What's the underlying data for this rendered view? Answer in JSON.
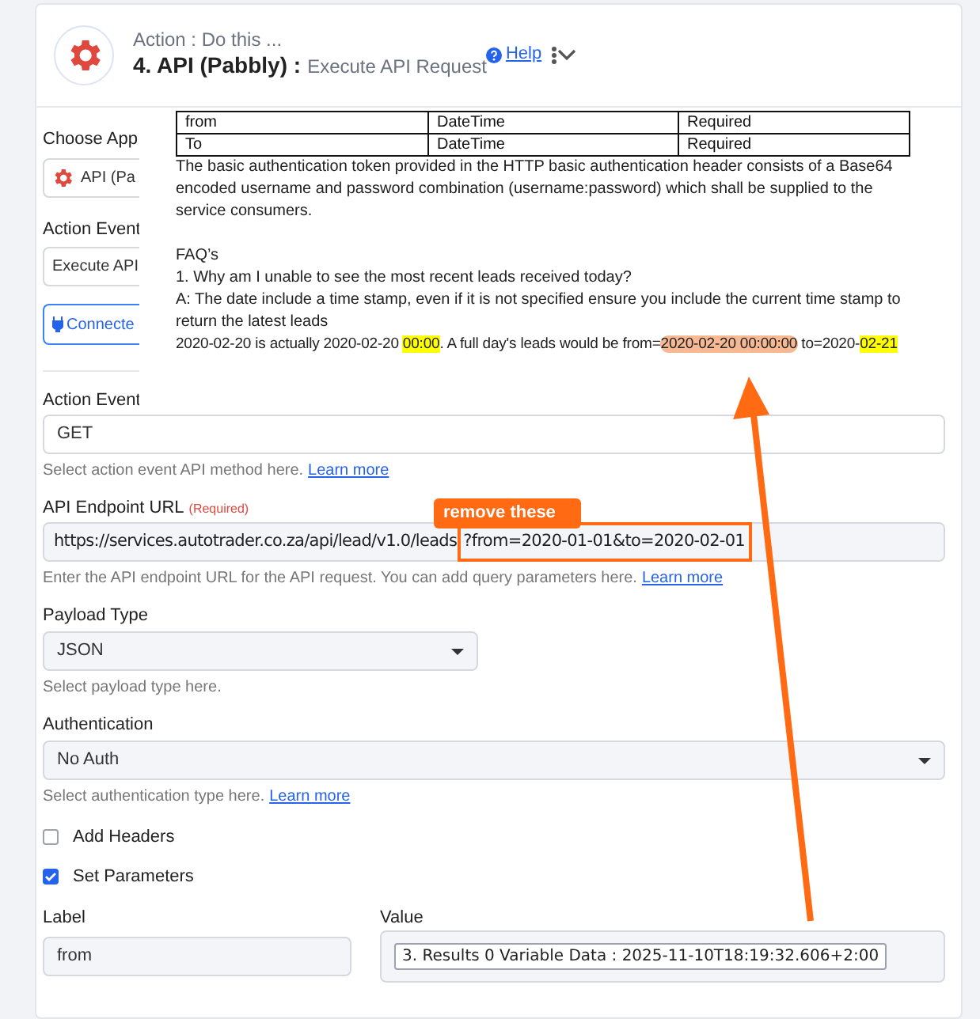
{
  "header": {
    "subtitle": "Action : Do this ...",
    "title": "4. API (Pabbly) :",
    "title_detail": "Execute API Request",
    "help": "Help"
  },
  "partial": {
    "choose_app_label": "Choose App",
    "app_value": "API (Pa",
    "action_event_label": "Action Event",
    "action_event_value": "Execute API",
    "connect_button": "Connecte"
  },
  "document": {
    "table": [
      [
        "from",
        "DateTime",
        "Required"
      ],
      [
        "To",
        "DateTime",
        "Required"
      ]
    ],
    "paragraph": "The basic authentication token provided in the HTTP basic authentication header consists of a Base64 encoded username and password combination (username:password) which shall be supplied to the service consumers.",
    "faq_title": "FAQ’s",
    "question": "1. Why am I unable to see the most recent leads received today?",
    "answer": "A: The date include a time stamp, even if it is not specified ensure you include the current time stamp to return the latest leads",
    "example": [
      {
        "text": "2020-02-20 is actually 2020-02-20 ",
        "kind": "plain"
      },
      {
        "text": "00:00",
        "kind": "yellow"
      },
      {
        "text": ". A full day's leads would be from=",
        "kind": "plain"
      },
      {
        "text": "2020-02-20 00:00:00",
        "kind": "salmon"
      },
      {
        "text": " to=2020-",
        "kind": "plain"
      },
      {
        "text": "02-21",
        "kind": "yellow"
      }
    ]
  },
  "method": {
    "label": "Action Event",
    "value": "GET",
    "help": "Select action event API method here.",
    "link": "Learn more"
  },
  "endpoint": {
    "label": "API Endpoint URL",
    "required": "(Required)",
    "value_base": "https://services.autotrader.co.za/api/lead/v1.0/leads",
    "value_query": "?from=2020-01-01&to=2020-02-01",
    "help": "Enter the API endpoint URL for the API request. You can add query parameters here.",
    "link": "Learn more"
  },
  "payload": {
    "label": "Payload Type",
    "value": "JSON",
    "help": "Select payload type here."
  },
  "auth": {
    "label": "Authentication",
    "value": "No Auth",
    "help": "Select authentication type here.",
    "link": "Learn more"
  },
  "options": [
    {
      "label": "Add Headers",
      "checked": false
    },
    {
      "label": "Set Parameters",
      "checked": true
    }
  ],
  "params": {
    "label_heading": "Label",
    "value_heading": "Value",
    "label_value": "from",
    "value": "3. Results 0 Variable Data : 2025-11-10T18:19:32.606+2:00"
  },
  "annotation": {
    "callout": "remove these"
  }
}
